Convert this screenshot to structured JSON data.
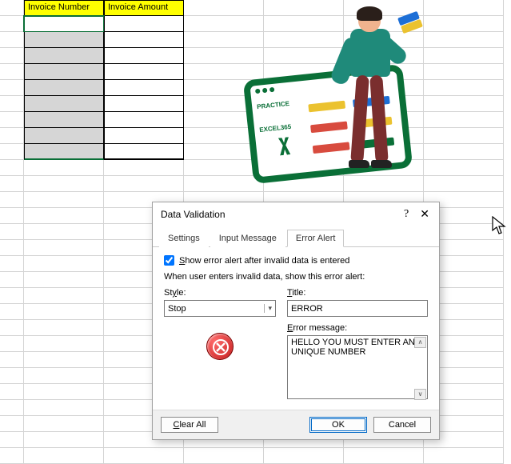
{
  "spreadsheet": {
    "headers": [
      "Invoice Number",
      "Invoice Amount"
    ]
  },
  "illustration": {
    "brand_line1": "PRACTICE",
    "brand_line2": "EXCEL365"
  },
  "dialog": {
    "title": "Data Validation",
    "tabs": {
      "settings": "Settings",
      "input_message": "Input Message",
      "error_alert": "Error Alert"
    },
    "checkbox_label": "Show error alert after invalid data is entered",
    "checkbox_checked": true,
    "subhead": "When user enters invalid data, show this error alert:",
    "style_label": "Style:",
    "style_value": "Stop",
    "title_field_label": "Title:",
    "title_field_value": "ERROR",
    "message_label": "Error message:",
    "message_value": "HELLO YOU MUST ENTER AN UNIQUE NUMBER",
    "buttons": {
      "clear_all": "Clear All",
      "ok": "OK",
      "cancel": "Cancel"
    }
  }
}
